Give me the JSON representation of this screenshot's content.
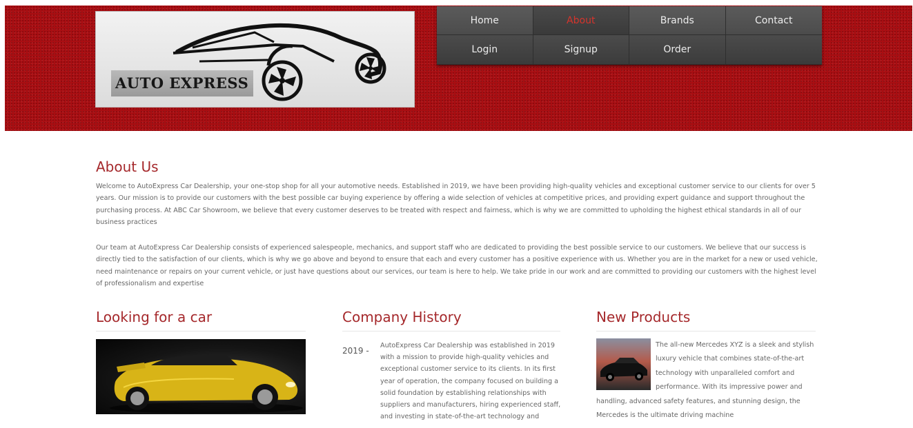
{
  "logo": {
    "text": "AUTO EXPRESS"
  },
  "nav": {
    "items": [
      {
        "label": "Home",
        "active": false
      },
      {
        "label": "About",
        "active": true
      },
      {
        "label": "Brands",
        "active": false
      },
      {
        "label": "Contact",
        "active": false
      },
      {
        "label": "Login",
        "active": false
      },
      {
        "label": "Signup",
        "active": false
      },
      {
        "label": "Order",
        "active": false
      }
    ]
  },
  "about": {
    "title": "About Us",
    "paragraph1": "Welcome to AutoExpress Car Dealership, your one-stop shop for all your automotive needs. Established in 2019, we have been providing high-quality vehicles and exceptional customer service to our clients for over 5 years. Our mission is to provide our customers with the best possible car buying experience by offering a wide selection of vehicles at competitive prices, and providing expert guidance and support throughout the purchasing process. At ABC Car Showroom, we believe that every customer deserves to be treated with respect and fairness, which is why we are committed to upholding the highest ethical standards in all of our business practices",
    "paragraph2": "Our team at AutoExpress Car Dealership consists of experienced salespeople, mechanics, and support staff who are dedicated to providing the best possible service to our customers. We believe that our success is directly tied to the satisfaction of our clients, which is why we go above and beyond to ensure that each and every customer has a positive experience with us. Whether you are in the market for a new or used vehicle, need maintenance or repairs on your current vehicle, or just have questions about our services, our team is here to help. We take pride in our work and are committed to providing our customers with the highest level of professionalism and expertise"
  },
  "looking": {
    "title": "Looking for a car"
  },
  "history": {
    "title": "Company History",
    "year": "2019 -",
    "text": "AutoExpress Car Dealership was established in 2019 with a mission to provide high-quality vehicles and exceptional customer service to its clients. In its first year of operation, the company focused on building a solid foundation by establishing relationships with suppliers and manufacturers, hiring experienced staff, and investing in state-of-the-art technology and"
  },
  "products": {
    "title": "New Products",
    "text": "The all-new Mercedes XYZ is a sleek and stylish luxury vehicle that combines state-of-the-art technology with unparalleled comfort and performance. With its impressive power and handling, advanced safety features, and stunning design, the Mercedes is the ultimate driving machine"
  },
  "colors": {
    "header_red": "#a90e12",
    "accent_red": "#a5282b",
    "nav_active": "#d6342c"
  }
}
